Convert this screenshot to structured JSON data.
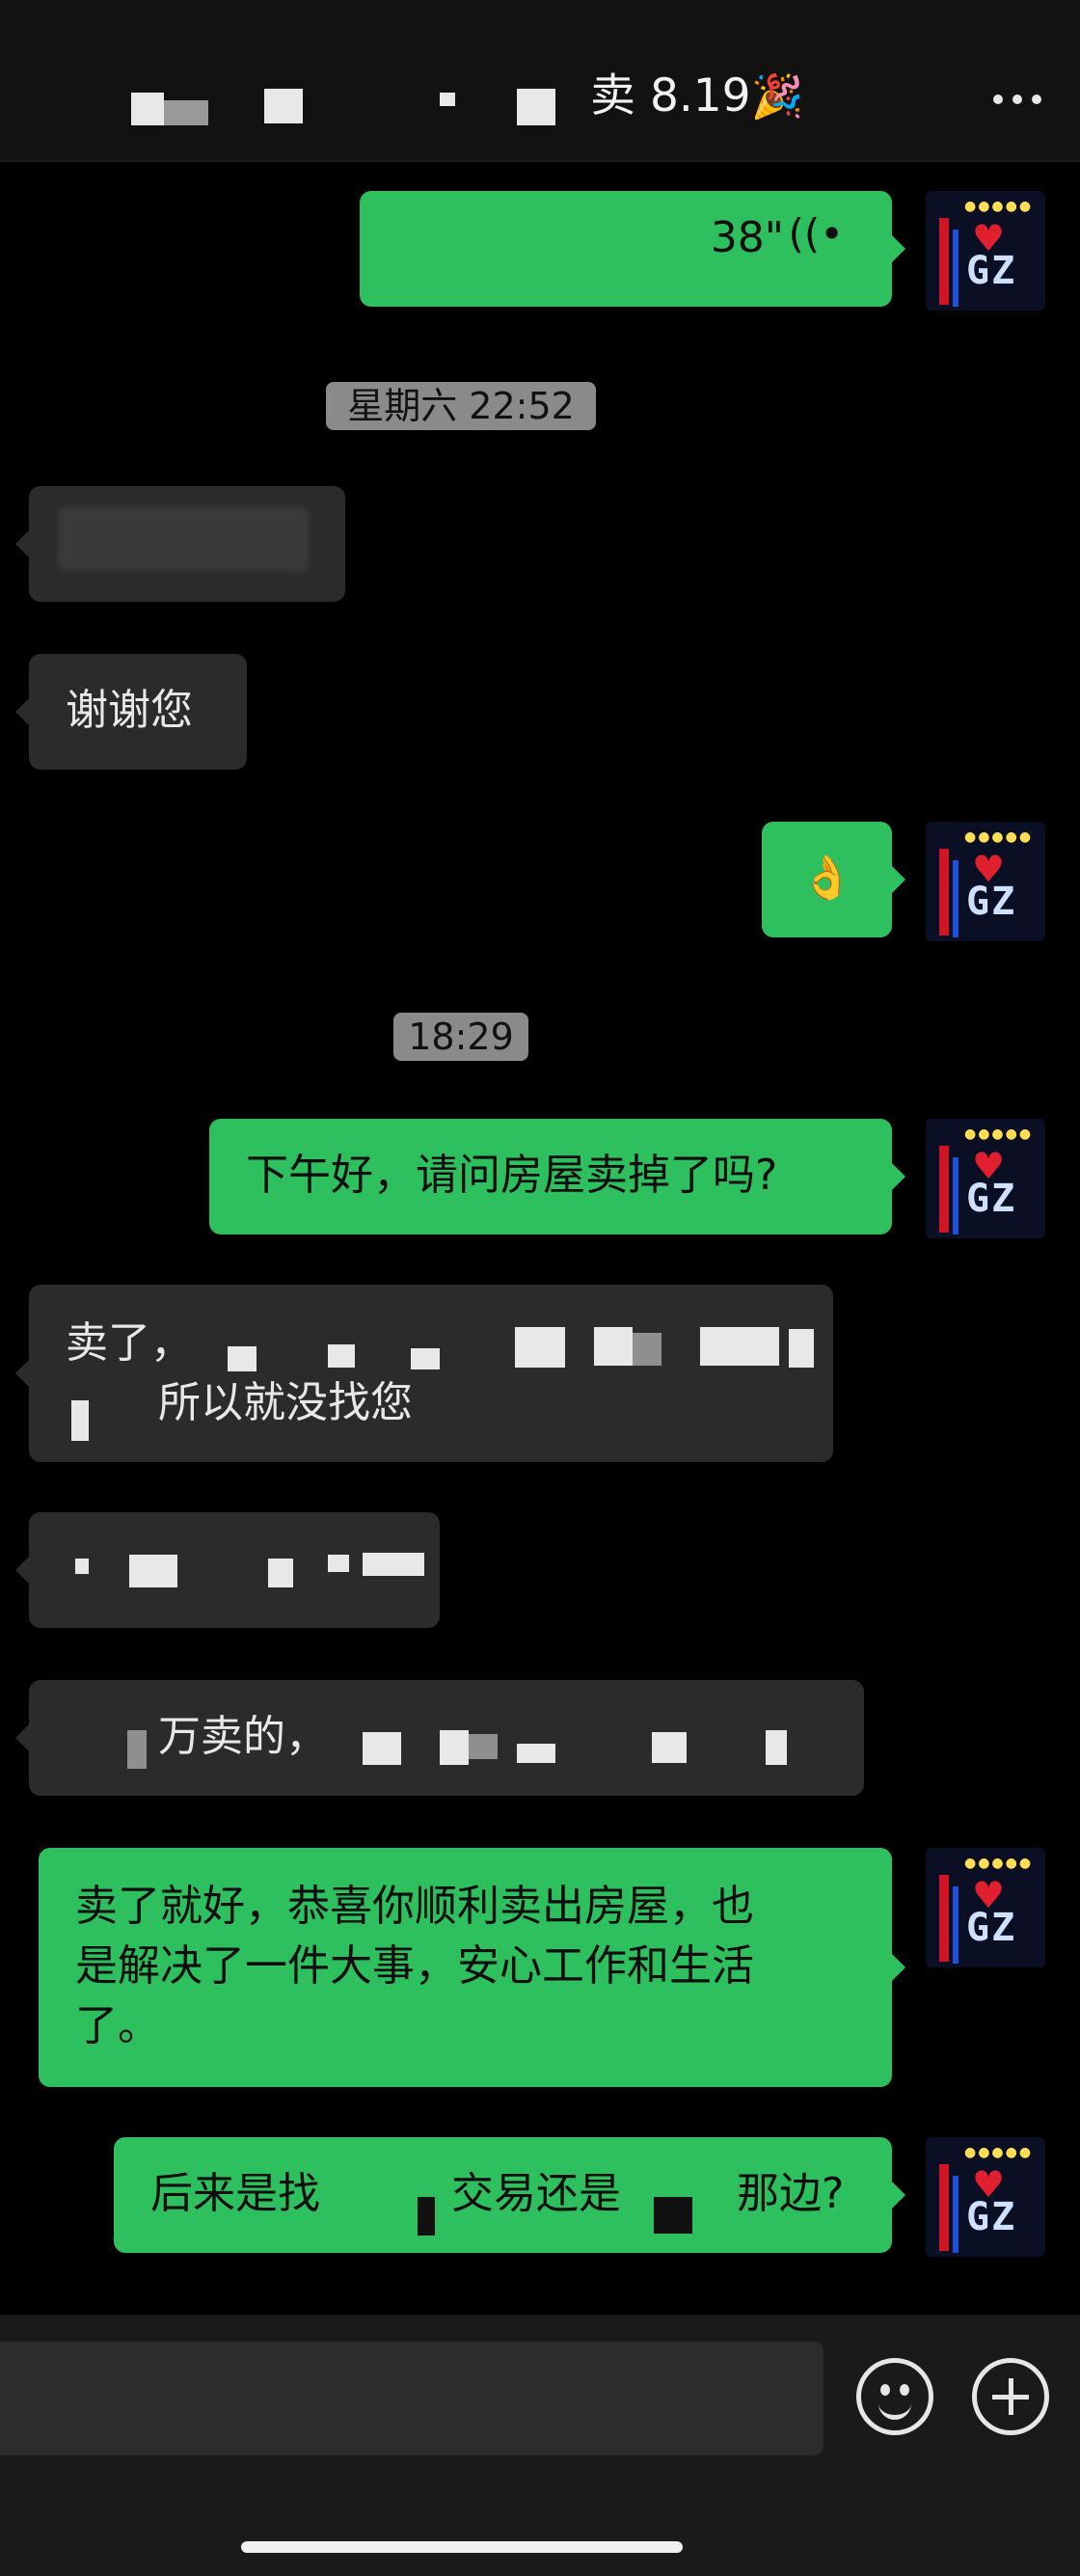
{
  "header": {
    "title": "卖 8.19",
    "title_emoji": "🎉"
  },
  "messages": [
    {
      "type": "voice",
      "direction": "out",
      "duration": "38\""
    },
    {
      "type": "timestamp",
      "text": "星期六 22:52"
    },
    {
      "type": "text",
      "direction": "in",
      "text": ""
    },
    {
      "type": "text",
      "direction": "in",
      "text": "谢谢您"
    },
    {
      "type": "emoji",
      "direction": "out",
      "text": "👌"
    },
    {
      "type": "timestamp",
      "text": "18:29"
    },
    {
      "type": "text",
      "direction": "out",
      "text": "下午好，请问房屋卖掉了吗?"
    },
    {
      "type": "text",
      "direction": "in",
      "line1": "卖了，",
      "line2": "所以就没找您"
    },
    {
      "type": "text",
      "direction": "in",
      "text": ""
    },
    {
      "type": "text",
      "direction": "in",
      "text": "万卖的，"
    },
    {
      "type": "text",
      "direction": "out",
      "line1": "卖了就好，恭喜你顺利卖出房屋，也",
      "line2": "是解决了一件大事，安心工作和生活",
      "line3": "了。"
    },
    {
      "type": "text",
      "direction": "out",
      "part1": "后来是找",
      "part2": "交易还是",
      "part3": "那边?"
    }
  ],
  "icons": {
    "more": "more-dots-icon",
    "voice": "voice-wave-icon",
    "emoji_button": "smiley-icon",
    "plus_button": "plus-icon"
  },
  "colors": {
    "outgoing_bubble": "#2ec05e",
    "incoming_bubble": "#2b2b2b",
    "background": "#000000"
  }
}
